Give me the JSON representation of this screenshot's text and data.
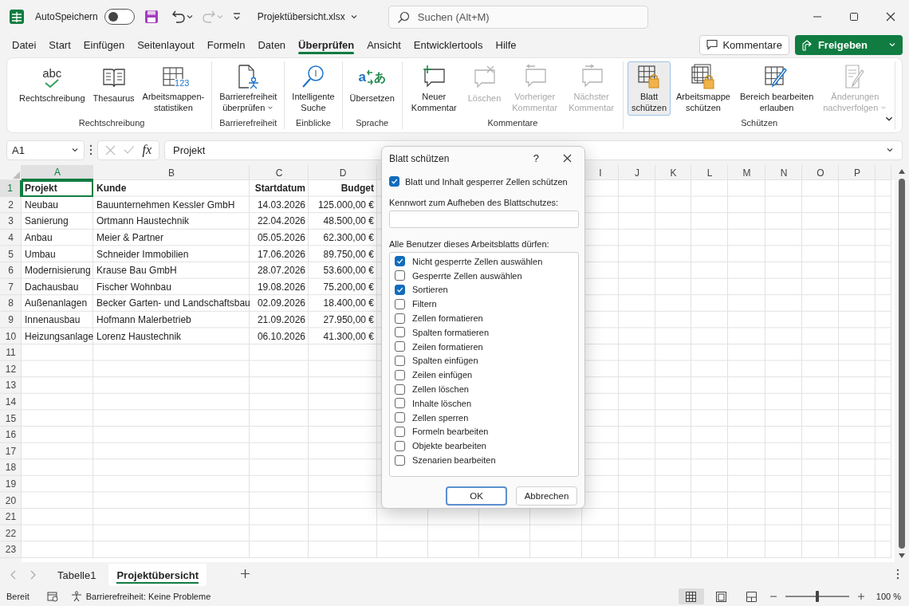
{
  "title_bar": {
    "autosave": {
      "label": "AutoSpeichern",
      "on": false
    },
    "file_name": "Projektübersicht.xlsx",
    "search": {
      "placeholder": "Suchen (Alt+M)"
    }
  },
  "menu_tabs": [
    {
      "label": "Datei",
      "selected": false
    },
    {
      "label": "Start",
      "selected": false
    },
    {
      "label": "Einfügen",
      "selected": false
    },
    {
      "label": "Seitenlayout",
      "selected": false
    },
    {
      "label": "Formeln",
      "selected": false
    },
    {
      "label": "Daten",
      "selected": false
    },
    {
      "label": "Überprüfen",
      "selected": true
    },
    {
      "label": "Ansicht",
      "selected": false
    },
    {
      "label": "Entwicklertools",
      "selected": false
    },
    {
      "label": "Hilfe",
      "selected": false
    }
  ],
  "header_buttons": {
    "comments": "Kommentare",
    "share": "Freigeben"
  },
  "ribbon": {
    "groups": [
      {
        "label": "Rechtschreibung",
        "commands": [
          {
            "lines": [
              "Rechtschreibung"
            ],
            "icon_text": [
              "abc"
            ],
            "disabled": false,
            "active": false,
            "dropdown": false
          },
          {
            "lines": [
              "Thesaurus"
            ],
            "disabled": false,
            "active": false,
            "dropdown": false
          },
          {
            "lines": [
              "Arbeitsmappen-",
              "statistiken"
            ],
            "icon_text": [
              "123"
            ],
            "disabled": false,
            "active": false,
            "dropdown": false
          }
        ]
      },
      {
        "label": "Barrierefreiheit",
        "commands": [
          {
            "lines": [
              "Barrierefreiheit",
              "überprüfen"
            ],
            "disabled": false,
            "active": false,
            "dropdown": true
          }
        ]
      },
      {
        "label": "Einblicke",
        "commands": [
          {
            "lines": [
              "Intelligente",
              "Suche"
            ],
            "disabled": false,
            "active": false,
            "dropdown": false
          }
        ]
      },
      {
        "label": "Sprache",
        "commands": [
          {
            "lines": [
              "Übersetzen"
            ],
            "icon_text": [
              "a",
              "あ"
            ],
            "disabled": false,
            "active": false,
            "dropdown": false
          }
        ]
      },
      {
        "label": "Kommentare",
        "commands": [
          {
            "lines": [
              "Neuer",
              "Kommentar"
            ],
            "disabled": false,
            "active": false,
            "dropdown": false
          },
          {
            "lines": [
              "Löschen"
            ],
            "disabled": true,
            "active": false,
            "dropdown": false
          },
          {
            "lines": [
              "Vorheriger",
              "Kommentar"
            ],
            "disabled": true,
            "active": false,
            "dropdown": false
          },
          {
            "lines": [
              "Nächster",
              "Kommentar"
            ],
            "disabled": true,
            "active": false,
            "dropdown": false
          }
        ]
      },
      {
        "label": "Schützen",
        "commands": [
          {
            "lines": [
              "Blatt",
              "schützen"
            ],
            "disabled": false,
            "active": true,
            "dropdown": false
          },
          {
            "lines": [
              "Arbeitsmappe",
              "schützen"
            ],
            "disabled": false,
            "active": false,
            "dropdown": false
          },
          {
            "lines": [
              "Bereich bearbeiten",
              "erlauben"
            ],
            "disabled": false,
            "active": false,
            "dropdown": false
          },
          {
            "lines": [
              "Änderungen",
              "nachverfolgen"
            ],
            "disabled": true,
            "active": false,
            "dropdown": true
          }
        ]
      }
    ]
  },
  "formula_bar": {
    "name_box": "A1",
    "function_label": "fx",
    "formula": "Projekt"
  },
  "sheet": {
    "columns": [
      {
        "label": "A",
        "selected": true
      },
      {
        "label": "B",
        "selected": false
      },
      {
        "label": "C",
        "selected": false
      },
      {
        "label": "D",
        "selected": false
      },
      {
        "label": "I",
        "selected": false
      },
      {
        "label": "J",
        "selected": false
      },
      {
        "label": "K",
        "selected": false
      },
      {
        "label": "L",
        "selected": false
      },
      {
        "label": "M",
        "selected": false
      },
      {
        "label": "N",
        "selected": false
      },
      {
        "label": "O",
        "selected": false
      },
      {
        "label": "P",
        "selected": false
      }
    ],
    "rows": [
      {
        "label": "1",
        "selected": true
      },
      {
        "label": "2",
        "selected": false
      },
      {
        "label": "3",
        "selected": false
      },
      {
        "label": "4",
        "selected": false
      },
      {
        "label": "5",
        "selected": false
      },
      {
        "label": "6",
        "selected": false
      },
      {
        "label": "7",
        "selected": false
      },
      {
        "label": "8",
        "selected": false
      },
      {
        "label": "9",
        "selected": false
      },
      {
        "label": "10",
        "selected": false
      },
      {
        "label": "11",
        "selected": false
      },
      {
        "label": "12",
        "selected": false
      },
      {
        "label": "13",
        "selected": false
      },
      {
        "label": "14",
        "selected": false
      },
      {
        "label": "15",
        "selected": false
      },
      {
        "label": "16",
        "selected": false
      },
      {
        "label": "17",
        "selected": false
      },
      {
        "label": "18",
        "selected": false
      },
      {
        "label": "19",
        "selected": false
      },
      {
        "label": "20",
        "selected": false
      },
      {
        "label": "21",
        "selected": false
      },
      {
        "label": "22",
        "selected": false
      },
      {
        "label": "23",
        "selected": false
      }
    ],
    "table": {
      "header": [
        "Projekt",
        "Kunde",
        "Startdatum",
        "Budget"
      ],
      "rows": [
        [
          "Neubau",
          "Bauunternehmen Kessler GmbH",
          "14.03.2026",
          "125.000,00 €"
        ],
        [
          "Sanierung",
          "Ortmann Haustechnik",
          "22.04.2026",
          "48.500,00 €"
        ],
        [
          "Anbau",
          "Meier & Partner",
          "05.05.2026",
          "62.300,00 €"
        ],
        [
          "Umbau",
          "Schneider Immobilien",
          "17.06.2026",
          "89.750,00 €"
        ],
        [
          "Modernisierung",
          "Krause Bau GmbH",
          "28.07.2026",
          "53.600,00 €"
        ],
        [
          "Dachausbau",
          "Fischer Wohnbau",
          "19.08.2026",
          "75.200,00 €"
        ],
        [
          "Außenanlagen",
          "Becker Garten- und Landschaftsbau",
          "02.09.2026",
          "18.400,00 €"
        ],
        [
          "Innenausbau",
          "Hofmann Malerbetrieb",
          "21.09.2026",
          "27.950,00 €"
        ],
        [
          "Heizungsanlage",
          "Lorenz Haustechnik",
          "06.10.2026",
          "41.300,00 €"
        ]
      ]
    }
  },
  "dialog": {
    "title": "Blatt schützen",
    "help": "?",
    "protect": {
      "label": "Blatt und Inhalt gesperrer Zellen schützen",
      "checked": true
    },
    "password_label": "Kennwort zum Aufheben des Blattschutzes:",
    "permissions_label": "Alle Benutzer dieses Arbeitsblatts dürfen:",
    "permissions": [
      {
        "label": "Nicht gesperrte Zellen auswählen",
        "checked": true
      },
      {
        "label": "Gesperrte Zellen auswählen",
        "checked": false
      },
      {
        "label": "Sortieren",
        "checked": true
      },
      {
        "label": "Filtern",
        "checked": false
      },
      {
        "label": "Zellen formatieren",
        "checked": false
      },
      {
        "label": "Spalten formatieren",
        "checked": false
      },
      {
        "label": "Zeilen formatieren",
        "checked": false
      },
      {
        "label": "Spalten einfügen",
        "checked": false
      },
      {
        "label": "Zeilen einfügen",
        "checked": false
      },
      {
        "label": "Zellen löschen",
        "checked": false
      },
      {
        "label": "Inhalte löschen",
        "checked": false
      },
      {
        "label": "Zellen sperren",
        "checked": false
      },
      {
        "label": "Formeln bearbeiten",
        "checked": false
      },
      {
        "label": "Objekte bearbeiten",
        "checked": false
      },
      {
        "label": "Szenarien bearbeiten",
        "checked": false
      }
    ],
    "buttons": [
      "OK",
      "Abbrechen"
    ]
  },
  "sheet_tabs": [
    {
      "label": "Tabelle1",
      "selected": false
    },
    {
      "label": "Projektübersicht",
      "selected": true
    }
  ],
  "status_bar": {
    "ready": "Bereit",
    "accessibility": "Barrierefreiheit: Keine Probleme",
    "views": [
      {
        "selected": true
      },
      {
        "selected": false
      },
      {
        "selected": false
      }
    ],
    "zoom": {
      "level": 0.5,
      "reading": "100 %"
    }
  }
}
